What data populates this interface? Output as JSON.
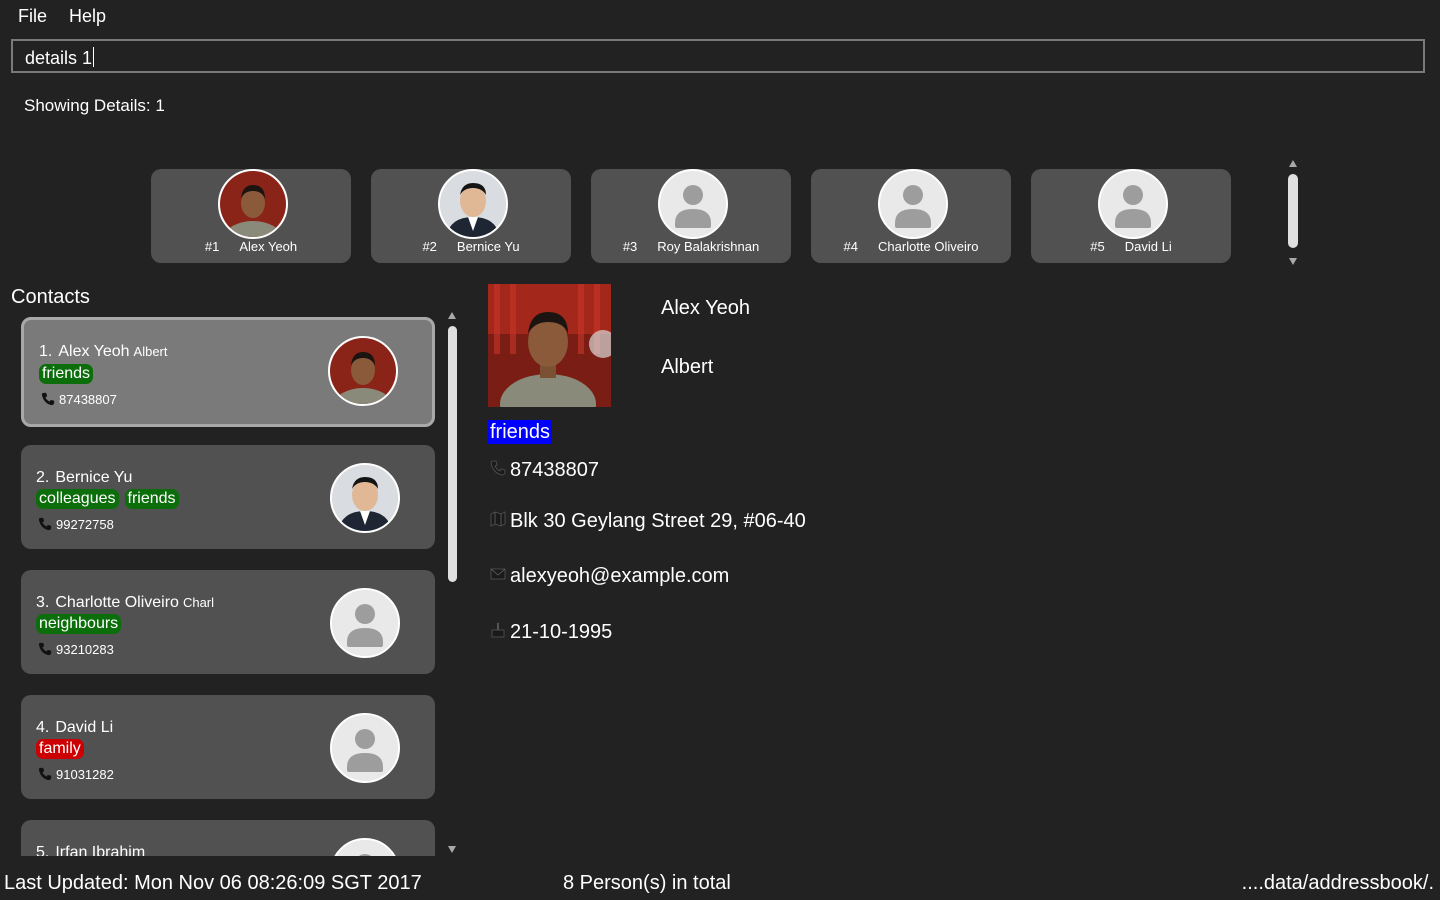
{
  "menu": {
    "file": "File",
    "help": "Help"
  },
  "command": {
    "value": "details 1"
  },
  "result": {
    "text": "Showing Details: 1"
  },
  "favourites": [
    {
      "index": "#1",
      "name": "Alex Yeoh",
      "photo": "alex"
    },
    {
      "index": "#2",
      "name": "Bernice Yu",
      "photo": "bernice"
    },
    {
      "index": "#3",
      "name": "Roy Balakrishnan",
      "photo": "placeholder"
    },
    {
      "index": "#4",
      "name": "Charlotte Oliveiro",
      "photo": "placeholder"
    },
    {
      "index": "#5",
      "name": "David Li",
      "photo": "placeholder"
    }
  ],
  "contacts": {
    "title": "Contacts",
    "items": [
      {
        "index": "1.",
        "name": "Alex Yeoh",
        "alias": "Albert",
        "tags": [
          "friends"
        ],
        "phone": "87438807",
        "photo": "alex",
        "selected": true
      },
      {
        "index": "2.",
        "name": "Bernice Yu",
        "alias": "",
        "tags": [
          "colleagues",
          "friends"
        ],
        "phone": "99272758",
        "photo": "bernice",
        "selected": false
      },
      {
        "index": "3.",
        "name": "Charlotte Oliveiro",
        "alias": "Charl",
        "tags": [
          "neighbours"
        ],
        "phone": "93210283",
        "photo": "placeholder",
        "selected": false
      },
      {
        "index": "4.",
        "name": "David Li",
        "alias": "",
        "tags": [
          "family"
        ],
        "phone": "91031282",
        "photo": "placeholder",
        "selected": false
      },
      {
        "index": "5.",
        "name": "Irfan Ibrahim",
        "alias": "",
        "tags": [],
        "phone": "",
        "photo": "placeholder",
        "selected": false
      }
    ]
  },
  "tag_colors": {
    "friends": "#0b6e0b",
    "colleagues": "#0b6e0b",
    "neighbours": "#0b6e0b",
    "family": "#cc0000"
  },
  "details": {
    "name": "Alex Yeoh",
    "alias": "Albert",
    "tag": "friends",
    "phone": "87438807",
    "address": "Blk 30 Geylang Street 29, #06-40",
    "email": "alexyeoh@example.com",
    "birthday": "21-10-1995"
  },
  "status": {
    "last_updated": "Last Updated: Mon Nov 06 08:26:09 SGT 2017",
    "total": "8 Person(s) in total",
    "path": "....data/addressbook/."
  }
}
